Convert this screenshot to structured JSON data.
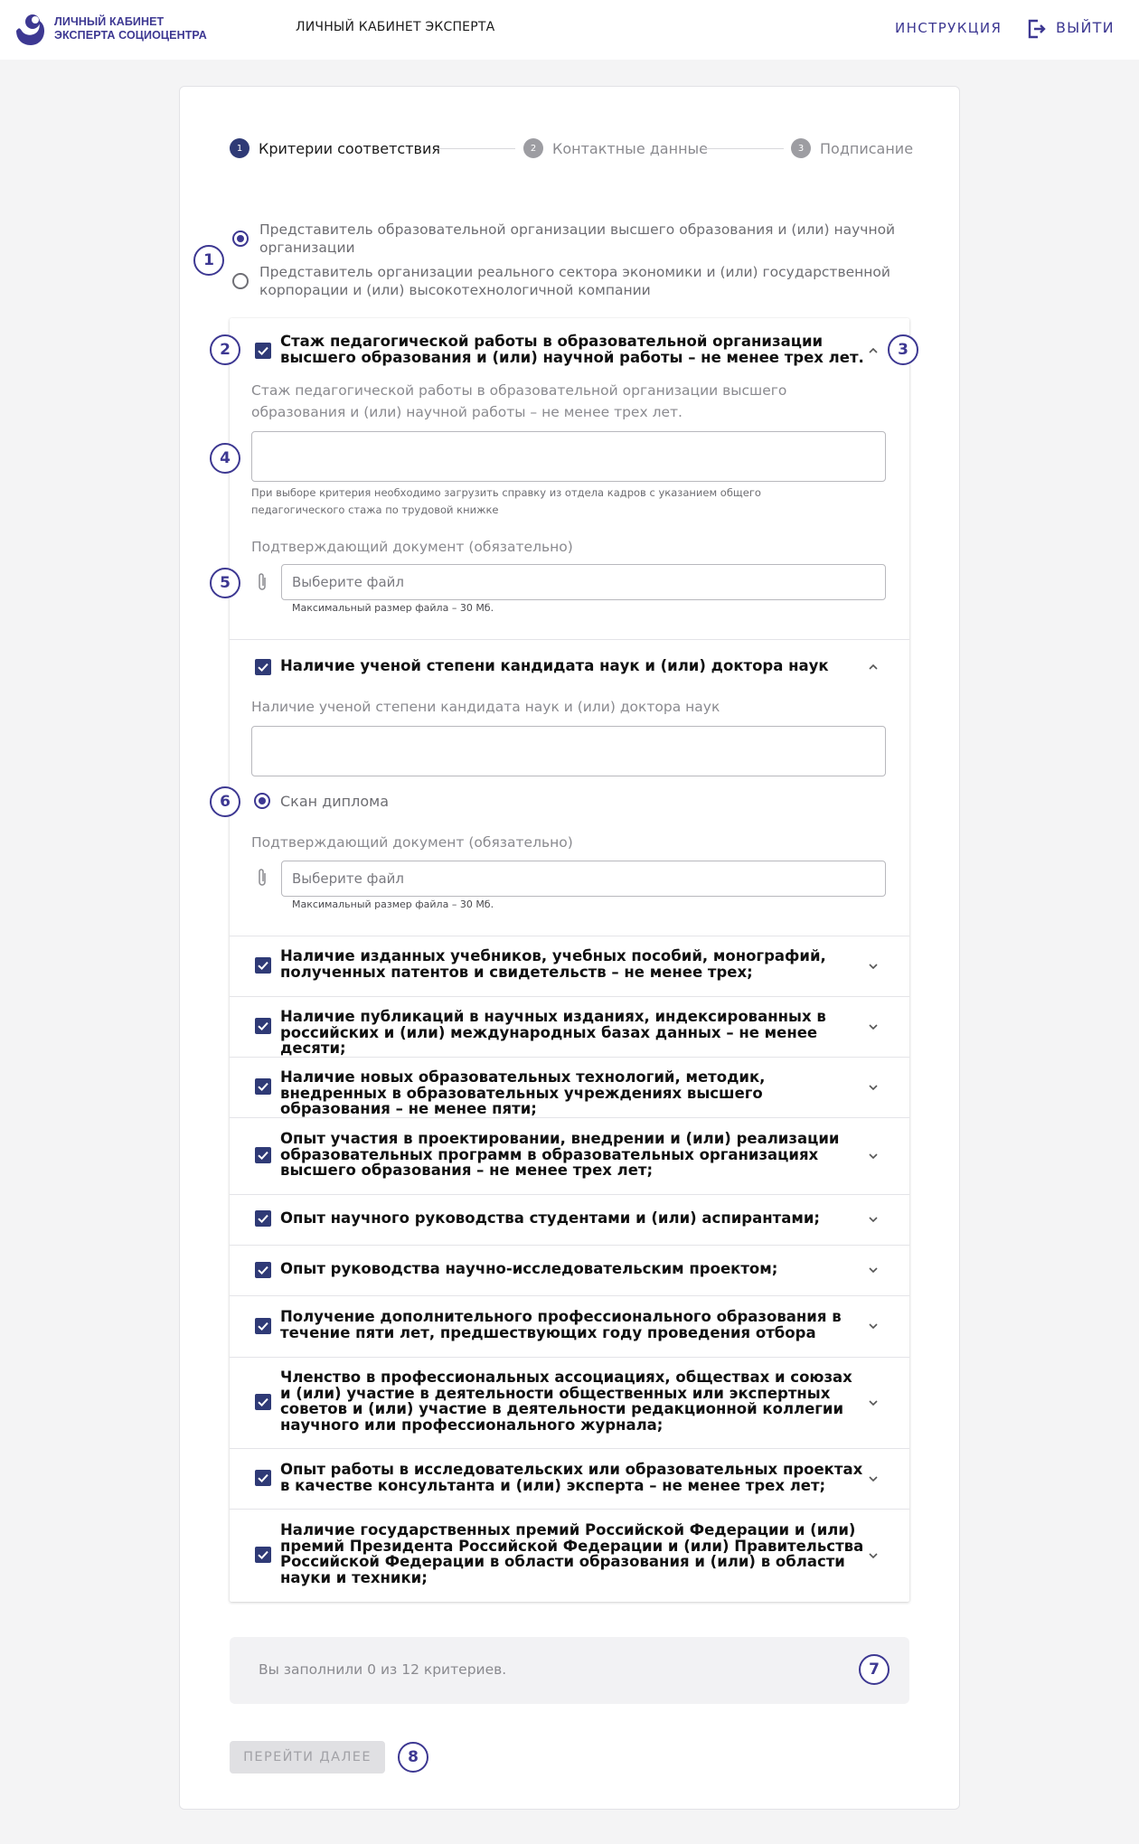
{
  "header": {
    "logo_line1": "ЛИЧНЫЙ КАБИНЕТ",
    "logo_line2": "ЭКСПЕРТА СОЦИОЦЕНТРА",
    "title": "ЛИЧНЫЙ КАБИНЕТ ЭКСПЕРТА",
    "instructions": "ИНСТРУКЦИЯ",
    "logout": "ВЫЙТИ",
    "brand_color": "#3d3892"
  },
  "stepper": [
    {
      "num": "1",
      "label": "Критерии соответствия",
      "active": true
    },
    {
      "num": "2",
      "label": "Контактные данные",
      "active": false
    },
    {
      "num": "3",
      "label": "Подписание",
      "active": false
    }
  ],
  "role_options": [
    {
      "text": "Представитель образовательной организации высшего образования и (или) научной организации",
      "selected": true
    },
    {
      "text": "Представитель организации реального сектора экономики и (или) государственной корпорации и (или) высокотехнологичной компании",
      "selected": false
    }
  ],
  "badges": [
    "1",
    "2",
    "3",
    "4",
    "5",
    "6",
    "7",
    "8"
  ],
  "criteria": [
    {
      "title": "Стаж педагогической работы в образовательной организации высшего образования и (или) научной работы – не менее трех лет.",
      "checked": true,
      "expanded": true
    },
    {
      "title": "Наличие ученой степени кандидата наук и (или) доктора наук",
      "checked": true,
      "expanded": true
    },
    {
      "title": "Наличие изданных учебников, учебных пособий, монографий, полученных патентов и свидетельств – не менее трех;",
      "checked": true,
      "expanded": false
    },
    {
      "title": "Наличие публикаций в научных изданиях, индексированных в российских и (или) международных базах данных – не менее десяти;",
      "checked": true,
      "expanded": false
    },
    {
      "title": "Наличие новых образовательных технологий, методик, внедренных в образовательных учреждениях высшего образования – не менее пяти;",
      "checked": true,
      "expanded": false
    },
    {
      "title": "Опыт участия в проектировании, внедрении и (или) реализации образовательных программ в образовательных организациях высшего образования – не менее трех лет;",
      "checked": true,
      "expanded": false
    },
    {
      "title": "Опыт научного руководства студентами и (или) аспирантами;",
      "checked": true,
      "expanded": false
    },
    {
      "title": "Опыт руководства научно-исследовательским проектом;",
      "checked": true,
      "expanded": false
    },
    {
      "title": "Получение дополнительного профессионального образования в течение пяти лет, предшествующих году проведения отбора",
      "checked": true,
      "expanded": false
    },
    {
      "title": "Членство в профессиональных ассоциациях, обществах и союзах и (или) участие в деятельности общественных или экспертных советов и (или) участие в деятельности редакционной коллегии научного или профессионального журнала;",
      "checked": true,
      "expanded": false
    },
    {
      "title": "Опыт работы в исследовательских или образовательных проектах в качестве консультанта и (или) эксперта – не менее трех лет;",
      "checked": true,
      "expanded": false
    },
    {
      "title": "Наличие государственных премий Российской Федерации и (или) премий Президента Российской Федерации и (или) Правительства Российской Федерации в области образования и (или) в области науки и техники;",
      "checked": true,
      "expanded": false
    }
  ],
  "panel1": {
    "label": "Стаж педагогической работы в образовательной организации высшего образования и (или) научной работы – не менее трех лет.",
    "hint": "При выборе критерия необходимо загрузить справку из отдела кадров с указанием общего педагогического стажа по трудовой книжке",
    "doc_label": "Подтверждающий документ (обязательно)",
    "file_placeholder": "Выберите файл",
    "max_size": "Максимальный размер файла – 30 Мб."
  },
  "panel2": {
    "label": "Наличие ученой степени кандидата наук и (или) доктора наук",
    "scan_option": "Скан диплома",
    "doc_label": "Подтверждающий документ (обязательно)",
    "file_placeholder": "Выберите файл",
    "max_size": "Максимальный размер файла – 30 Мб."
  },
  "summary": "Вы заполнили 0 из 12 критериев.",
  "next_button": "ПЕРЕЙТИ ДАЛЕЕ"
}
